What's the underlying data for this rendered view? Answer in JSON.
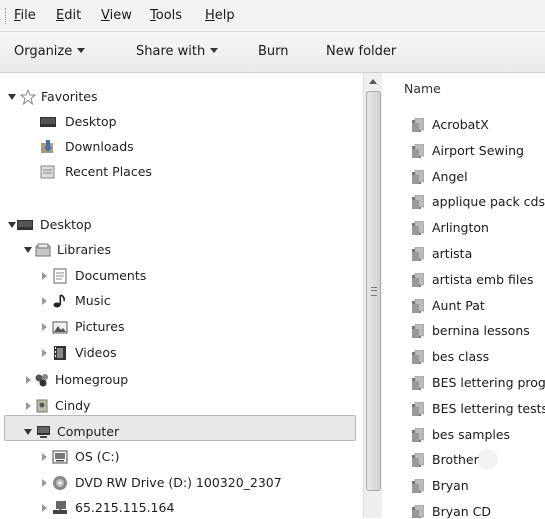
{
  "menu": [
    {
      "label": "File",
      "key": "F",
      "rest": "ile"
    },
    {
      "label": "Edit",
      "key": "E",
      "rest": "dit"
    },
    {
      "label": "View",
      "key": "V",
      "rest": "iew"
    },
    {
      "label": "Tools",
      "key": "T",
      "rest": "ools"
    },
    {
      "label": "Help",
      "key": "H",
      "rest": "elp"
    }
  ],
  "toolbar": {
    "organize": "Organize",
    "share": "Share with",
    "burn": "Burn",
    "new_folder": "New folder"
  },
  "nav": {
    "items": [
      {
        "label": "Favorites",
        "icon": "star-icon"
      },
      {
        "label": "Desktop",
        "icon": "desktop-icon"
      },
      {
        "label": "Downloads",
        "icon": "downloads-icon"
      },
      {
        "label": "Recent Places",
        "icon": "recent-places-icon"
      },
      {
        "label": "Desktop",
        "icon": "desktop-icon"
      },
      {
        "label": "Libraries",
        "icon": "libraries-icon"
      },
      {
        "label": "Documents",
        "icon": "documents-icon"
      },
      {
        "label": "Music",
        "icon": "music-icon"
      },
      {
        "label": "Pictures",
        "icon": "pictures-icon"
      },
      {
        "label": "Videos",
        "icon": "videos-icon"
      },
      {
        "label": "Homegroup",
        "icon": "homegroup-icon"
      },
      {
        "label": "Cindy",
        "icon": "user-icon"
      },
      {
        "label": "Computer",
        "icon": "computer-icon"
      },
      {
        "label": "OS (C:)",
        "icon": "drive-icon"
      },
      {
        "label": "DVD RW Drive (D:) 100320_2307",
        "icon": "dvd-icon"
      },
      {
        "label": "65.215.115.164",
        "icon": "network-drive-icon"
      }
    ]
  },
  "files": {
    "column_name": "Name",
    "items": [
      "AcrobatX",
      "Airport Sewing",
      "Angel",
      "applique pack cds",
      "Arlington",
      "artista",
      "artista emb files",
      "Aunt Pat",
      "bernina lessons",
      "bes class",
      "BES lettering prog",
      "BES lettering tests",
      "bes samples",
      "Brother",
      "Bryan",
      "Bryan CD"
    ]
  },
  "colors": {
    "selection": "#e8e8e8",
    "toolbar": "#efefef"
  }
}
